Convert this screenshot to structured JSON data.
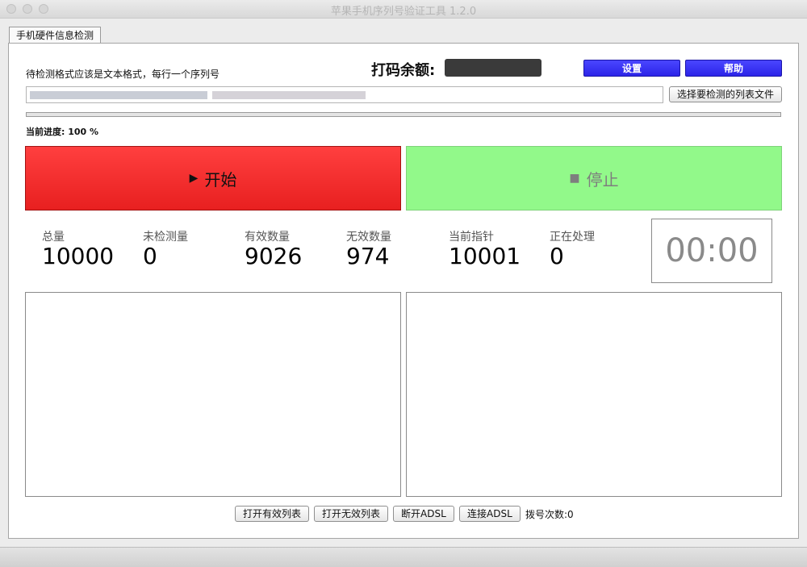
{
  "window": {
    "title": "苹果手机序列号验证工具 1.2.0"
  },
  "tab": {
    "label": "手机硬件信息检测"
  },
  "header": {
    "hint": "待检测格式应该是文本格式，每行一个序列号",
    "balance_label": "打码余额:",
    "settings_label": "设置",
    "help_label": "帮助",
    "accent_color": "#2c24e8"
  },
  "file": {
    "path": "",
    "choose_label": "选择要检测的列表文件"
  },
  "progress": {
    "value": 1.0,
    "text": "当前进度: 100 %"
  },
  "controls": {
    "start_glyph": "▶",
    "start_label": "开始",
    "start_color": "#e82020",
    "stop_glyph": "■",
    "stop_label": "停止",
    "stop_color": "#92f98a"
  },
  "stats": [
    {
      "label": "总量",
      "value": "10000"
    },
    {
      "label": "未检测量",
      "value": "0"
    },
    {
      "label": "有效数量",
      "value": "9026"
    },
    {
      "label": "无效数量",
      "value": "974"
    },
    {
      "label": "当前指针",
      "value": "10001"
    },
    {
      "label": "正在处理",
      "value": "0"
    }
  ],
  "timer": "00:00",
  "footer": {
    "open_valid_label": "打开有效列表",
    "open_invalid_label": "打开无效列表",
    "disconnect_label": "断开ADSL",
    "connect_label": "连接ADSL",
    "dial_count": "拨号次数:0"
  }
}
